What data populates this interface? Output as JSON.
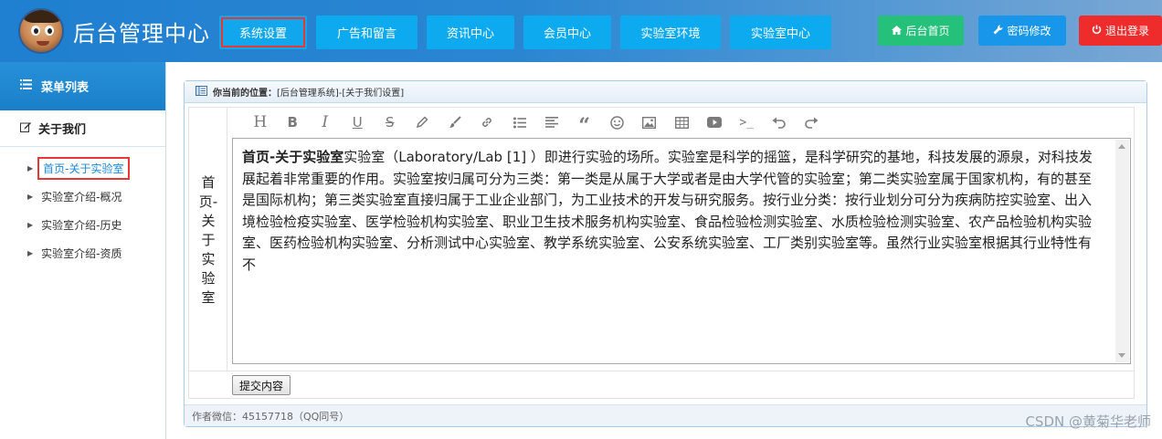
{
  "header": {
    "app_title": "后台管理中心",
    "nav": [
      {
        "label": "系统设置",
        "active": true
      },
      {
        "label": "广告和留言",
        "active": false
      },
      {
        "label": "资讯中心",
        "active": false
      },
      {
        "label": "会员中心",
        "active": false
      },
      {
        "label": "实验室环境",
        "active": false
      },
      {
        "label": "实验室中心",
        "active": false
      }
    ],
    "actions": {
      "home": {
        "label": "后台首页",
        "icon": "home-icon"
      },
      "password": {
        "label": "密码修改",
        "icon": "wrench-icon"
      },
      "logout": {
        "label": "退出登录",
        "icon": "power-icon"
      }
    }
  },
  "sidebar": {
    "title": "菜单列表",
    "section": "关于我们",
    "items": [
      {
        "label": "首页-关于实验室",
        "active": true
      },
      {
        "label": "实验室介绍-概况",
        "active": false
      },
      {
        "label": "实验室介绍-历史",
        "active": false
      },
      {
        "label": "实验室介绍-资质",
        "active": false
      }
    ]
  },
  "panel": {
    "location_label": "你当前的位置：",
    "location_path": "[后台管理系统]-[关于我们设置]",
    "field_label": "首页-关于实验室",
    "editor": {
      "toolbar_icons": [
        "heading-icon",
        "bold-icon",
        "italic-icon",
        "underline-icon",
        "strikethrough-icon",
        "pen-icon",
        "brush-icon",
        "link-icon",
        "list-icon",
        "align-icon",
        "quote-icon",
        "emoji-icon",
        "image-icon",
        "table-icon",
        "video-icon",
        "code-icon",
        "undo-icon",
        "redo-icon"
      ],
      "content_bold": "首页-关于实验室",
      "content_text": "实验室（Laboratory/Lab [1] ）即进行实验的场所。实验室是科学的摇篮，是科学研究的基地，科技发展的源泉，对科技发展起着非常重要的作用。实验室按归属可分为三类：第一类是从属于大学或者是由大学代管的实验室；第二类实验室属于国家机构，有的甚至是国际机构；第三类实验室直接归属于工业企业部门，为工业技术的开发与研究服务。按行业分类：按行业划分可分为疾病防控实验室、出入境检验检疫实验室、医学检验机构实验室、职业卫生技术服务机构实验室、食品检验检测实验室、水质检验检测实验室、农产品检验机构实验室、医药检验机构实验室、分析测试中心实验室、教学系统实验室、公安系统实验室、工厂类别实验室等。虽然行业实验室根据其行业特性有不"
    },
    "submit_label": "提交内容",
    "footer": "作者微信：45157718（QQ同号）"
  },
  "watermark": "CSDN @黄菊华老师",
  "colors": {
    "nav_bg": "#0eaaf0",
    "home_btn": "#25c17a",
    "password_btn": "#1796ea",
    "logout_btn": "#ee2c2c",
    "highlight": "#e53935"
  }
}
